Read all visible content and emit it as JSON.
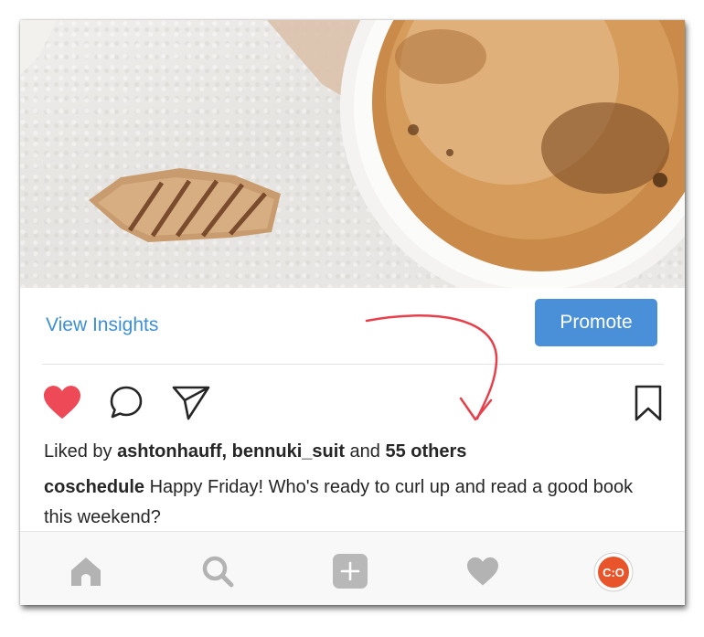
{
  "post": {
    "view_insights_label": "View Insights",
    "promote_label": "Promote",
    "liked": true,
    "likes": {
      "prefix": "Liked by",
      "user1": "ashtonhauff,",
      "user2": "bennuki_suit",
      "conjunction": "and",
      "others": "55 others"
    },
    "caption": {
      "username": "coschedule",
      "text": "Happy Friday! Who's ready to curl up and read a good book this weekend?"
    }
  },
  "icons": {
    "like": "heart-filled-icon",
    "comment": "comment-bubble-icon",
    "share": "paper-plane-icon",
    "save": "bookmark-icon"
  },
  "tabbar": {
    "items": [
      "home-icon",
      "search-icon",
      "add-icon",
      "activity-heart-icon",
      "profile-avatar"
    ],
    "avatar_text": "C:O"
  },
  "colors": {
    "accent_blue": "#3d8fd6",
    "promote_bg": "#4a90d9",
    "like_red": "#ed4956",
    "annotation_red": "#e8404b",
    "tab_icon_gray": "#b3b3b3",
    "avatar_orange": "#e8552b"
  }
}
